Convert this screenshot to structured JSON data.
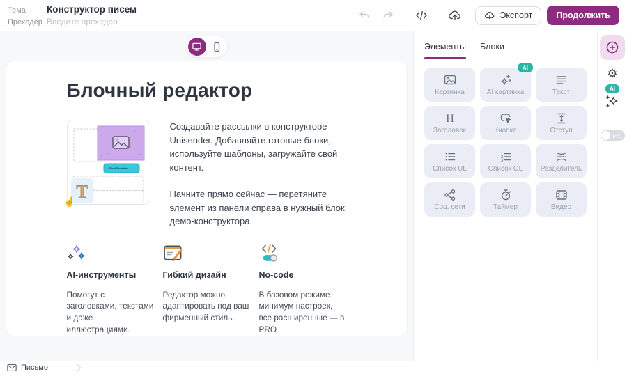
{
  "colors": {
    "brand": "#8C2B80",
    "teal_ai": "#2CB5A5",
    "canvas_bg": "#F7F8FA",
    "element_card_bg": "#EAEDF6",
    "accent_orange": "#F09A3E",
    "accent_blue": "#4FA8DC"
  },
  "topbar": {
    "subject_label": "Тема",
    "subject_value": "Конструктор писем",
    "preheader_label": "Прехедер",
    "preheader_placeholder": "Введите прехедер",
    "export_label": "Экспорт",
    "continue_label": "Продолжить"
  },
  "canvas": {
    "heading": "Блочный редактор",
    "paragraph1": "Создавайте рассылки в конструкторе Unisender. Добавляйте готовые блоки, используйте шаблоны, загружайте свой контент.",
    "paragraph2": "Начните прямо сейчас — перетяните элемент из панели справа в нужный блок демо-конструктора.",
    "features": [
      {
        "icon": "ai-sparkles-icon",
        "title": "AI-инструменты",
        "text": "Помогут с заголовками, текстами и даже иллюстрациями."
      },
      {
        "icon": "flexible-design-icon",
        "title": "Гибкий дизайн",
        "text": "Редактор можно адаптировать под ваш фирменный стиль."
      },
      {
        "icon": "no-code-icon",
        "title": "No-code",
        "text": "В базовом режиме минимум настроек, все расширенные — в PRO"
      }
    ]
  },
  "panel": {
    "tabs": [
      {
        "label": "Элементы",
        "active": true
      },
      {
        "label": "Блоки",
        "active": false
      }
    ],
    "elements": [
      {
        "label": "Картинка",
        "icon": "image-icon"
      },
      {
        "label": "AI картинка",
        "icon": "ai-image-icon",
        "badge": "AI"
      },
      {
        "label": "Текст",
        "icon": "text-icon"
      },
      {
        "label": "Заголовок",
        "icon": "heading-icon"
      },
      {
        "label": "Кнопка",
        "icon": "button-icon"
      },
      {
        "label": "Отступ",
        "icon": "spacer-icon"
      },
      {
        "label": "Список UL",
        "icon": "unordered-list-icon"
      },
      {
        "label": "Список OL",
        "icon": "ordered-list-icon"
      },
      {
        "label": "Разделитель",
        "icon": "divider-icon"
      },
      {
        "label": "Соц. сети",
        "icon": "social-share-icon"
      },
      {
        "label": "Таймер",
        "icon": "timer-icon"
      },
      {
        "label": "Видео",
        "icon": "video-icon"
      }
    ]
  },
  "rail": {
    "ai_badge": "AI",
    "pro_label": "Pro"
  },
  "bottombar": {
    "breadcrumb": "Письмо"
  }
}
